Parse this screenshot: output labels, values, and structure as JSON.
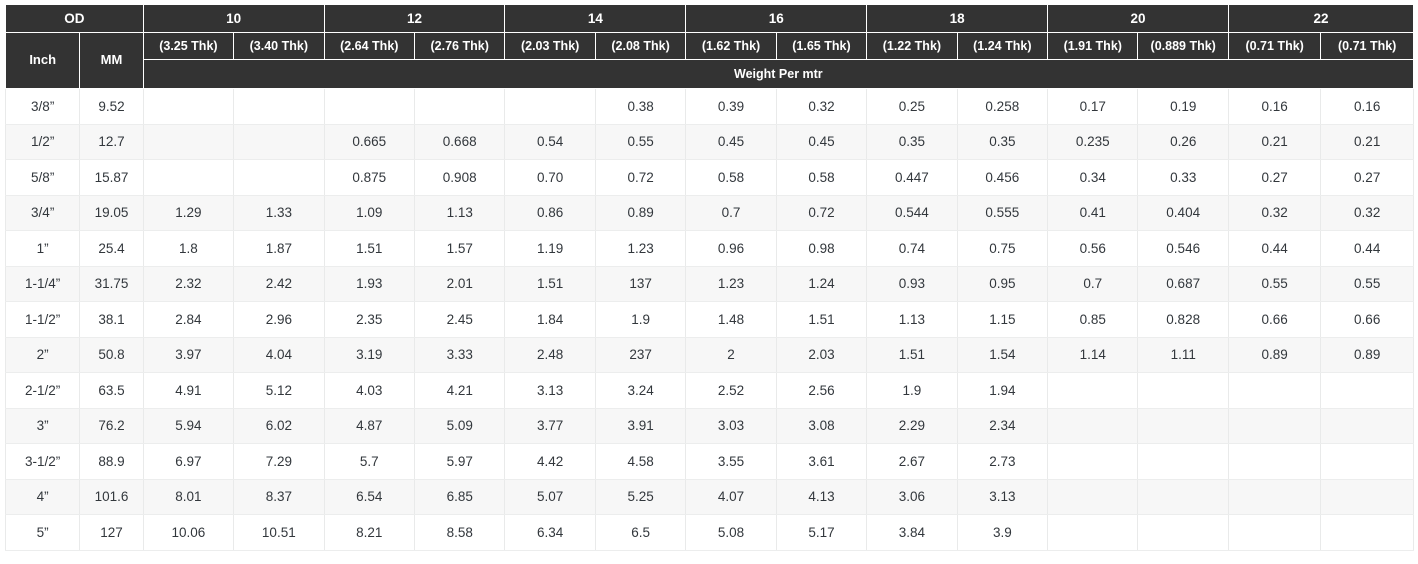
{
  "table": {
    "header": {
      "od_label": "OD",
      "od_sub": [
        "Inch",
        "MM"
      ],
      "size_groups": [
        "10",
        "12",
        "14",
        "16",
        "18",
        "20",
        "22"
      ],
      "thickness": [
        "(3.25 Thk)",
        "(3.40 Thk)",
        "(2.64 Thk)",
        "(2.76 Thk)",
        "(2.03 Thk)",
        "(2.08 Thk)",
        "(1.62 Thk)",
        "(1.65 Thk)",
        "(1.22 Thk)",
        "(1.24 Thk)",
        "(1.91 Thk)",
        "(0.889 Thk)",
        "(0.71 Thk)",
        "(0.71 Thk)"
      ],
      "weight_band": "Weight Per mtr"
    },
    "rows": [
      {
        "inch": "3/8”",
        "mm": "9.52",
        "values": [
          "",
          "",
          "",
          "",
          "",
          "0.38",
          "0.39",
          "0.32",
          "0.25",
          "0.258",
          "0.17",
          "0.19",
          "0.16",
          "0.16"
        ]
      },
      {
        "inch": "1/2”",
        "mm": "12.7",
        "values": [
          "",
          "",
          "0.665",
          "0.668",
          "0.54",
          "0.55",
          "0.45",
          "0.45",
          "0.35",
          "0.35",
          "0.235",
          "0.26",
          "0.21",
          "0.21"
        ]
      },
      {
        "inch": "5/8”",
        "mm": "15.87",
        "values": [
          "",
          "",
          "0.875",
          "0.908",
          "0.70",
          "0.72",
          "0.58",
          "0.58",
          "0.447",
          "0.456",
          "0.34",
          "0.33",
          "0.27",
          "0.27"
        ]
      },
      {
        "inch": "3/4”",
        "mm": "19.05",
        "values": [
          "1.29",
          "1.33",
          "1.09",
          "1.13",
          "0.86",
          "0.89",
          "0.7",
          "0.72",
          "0.544",
          "0.555",
          "0.41",
          "0.404",
          "0.32",
          "0.32"
        ]
      },
      {
        "inch": "1”",
        "mm": "25.4",
        "values": [
          "1.8",
          "1.87",
          "1.51",
          "1.57",
          "1.19",
          "1.23",
          "0.96",
          "0.98",
          "0.74",
          "0.75",
          "0.56",
          "0.546",
          "0.44",
          "0.44"
        ]
      },
      {
        "inch": "1-1/4”",
        "mm": "31.75",
        "values": [
          "2.32",
          "2.42",
          "1.93",
          "2.01",
          "1.51",
          "137",
          "1.23",
          "1.24",
          "0.93",
          "0.95",
          "0.7",
          "0.687",
          "0.55",
          "0.55"
        ]
      },
      {
        "inch": "1-1/2”",
        "mm": "38.1",
        "values": [
          "2.84",
          "2.96",
          "2.35",
          "2.45",
          "1.84",
          "1.9",
          "1.48",
          "1.51",
          "1.13",
          "1.15",
          "0.85",
          "0.828",
          "0.66",
          "0.66"
        ]
      },
      {
        "inch": "2”",
        "mm": "50.8",
        "values": [
          "3.97",
          "4.04",
          "3.19",
          "3.33",
          "2.48",
          "237",
          "2",
          "2.03",
          "1.51",
          "1.54",
          "1.14",
          "1.11",
          "0.89",
          "0.89"
        ]
      },
      {
        "inch": "2-1/2”",
        "mm": "63.5",
        "values": [
          "4.91",
          "5.12",
          "4.03",
          "4.21",
          "3.13",
          "3.24",
          "2.52",
          "2.56",
          "1.9",
          "1.94",
          "",
          "",
          "",
          ""
        ]
      },
      {
        "inch": "3”",
        "mm": "76.2",
        "values": [
          "5.94",
          "6.02",
          "4.87",
          "5.09",
          "3.77",
          "3.91",
          "3.03",
          "3.08",
          "2.29",
          "2.34",
          "",
          "",
          "",
          ""
        ]
      },
      {
        "inch": "3-1/2”",
        "mm": "88.9",
        "values": [
          "6.97",
          "7.29",
          "5.7",
          "5.97",
          "4.42",
          "4.58",
          "3.55",
          "3.61",
          "2.67",
          "2.73",
          "",
          "",
          "",
          ""
        ]
      },
      {
        "inch": "4”",
        "mm": "101.6",
        "values": [
          "8.01",
          "8.37",
          "6.54",
          "6.85",
          "5.07",
          "5.25",
          "4.07",
          "4.13",
          "3.06",
          "3.13",
          "",
          "",
          "",
          ""
        ]
      },
      {
        "inch": "5”",
        "mm": "127",
        "values": [
          "10.06",
          "10.51",
          "8.21",
          "8.58",
          "6.34",
          "6.5",
          "5.08",
          "5.17",
          "3.84",
          "3.9",
          "",
          "",
          "",
          ""
        ]
      }
    ]
  },
  "colors": {
    "header_bg": "#333333",
    "header_text": "#ffffff",
    "row_bg": "#ffffff",
    "row_alt_bg": "#f7f7f7",
    "grid_line": "#eceded",
    "body_text": "#32373c"
  }
}
